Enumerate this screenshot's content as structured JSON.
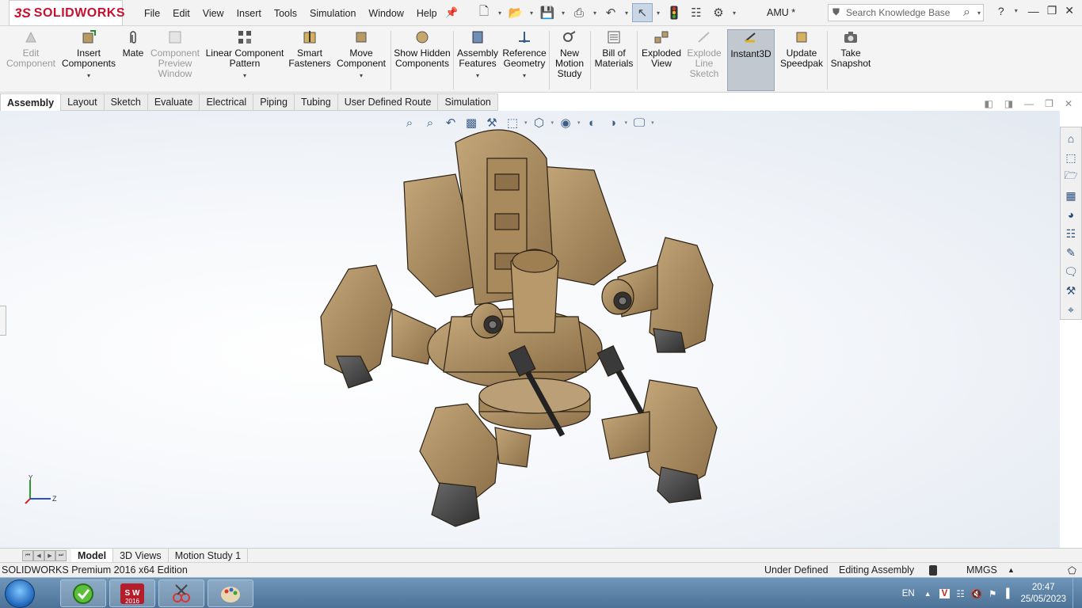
{
  "app": {
    "brand_ds": "3S",
    "brand_name": "SOLIDWORKS",
    "doc_title": "AMU *"
  },
  "menu": [
    "File",
    "Edit",
    "View",
    "Insert",
    "Tools",
    "Simulation",
    "Window",
    "Help"
  ],
  "search": {
    "placeholder": "Search Knowledge Base"
  },
  "ribbon": {
    "edit_component": "Edit Component",
    "insert_components": "Insert Components",
    "mate": "Mate",
    "component_preview": "Component Preview Window",
    "linear_pattern": "Linear Component Pattern",
    "smart_fasteners": "Smart Fasteners",
    "move_component": "Move Component",
    "show_hidden": "Show Hidden Components",
    "assembly_features": "Assembly Features",
    "reference_geometry": "Reference Geometry",
    "new_motion_study": "New Motion Study",
    "bill_of_materials": "Bill of Materials",
    "exploded_view": "Exploded View",
    "explode_line_sketch": "Explode Line Sketch",
    "instant3d": "Instant3D",
    "update_speedpak": "Update Speedpak",
    "take_snapshot": "Take Snapshot"
  },
  "tabs": [
    "Assembly",
    "Layout",
    "Sketch",
    "Evaluate",
    "Electrical",
    "Piping",
    "Tubing",
    "User Defined Route",
    "Simulation"
  ],
  "triad": {
    "y": "Y",
    "z": "Z"
  },
  "bottom_tabs": [
    "Model",
    "3D Views",
    "Motion Study 1"
  ],
  "status": {
    "edition": "SOLIDWORKS Premium 2016 x64 Edition",
    "definition": "Under Defined",
    "mode": "Editing Assembly",
    "units": "MMGS"
  },
  "taskbar": {
    "sw_label": "2016",
    "lang": "EN",
    "time": "20:47",
    "date": "25/05/2023"
  },
  "colors": {
    "brand": "#c8102e",
    "model_tan": "#a88a5e",
    "model_dark": "#4a4a4a"
  }
}
